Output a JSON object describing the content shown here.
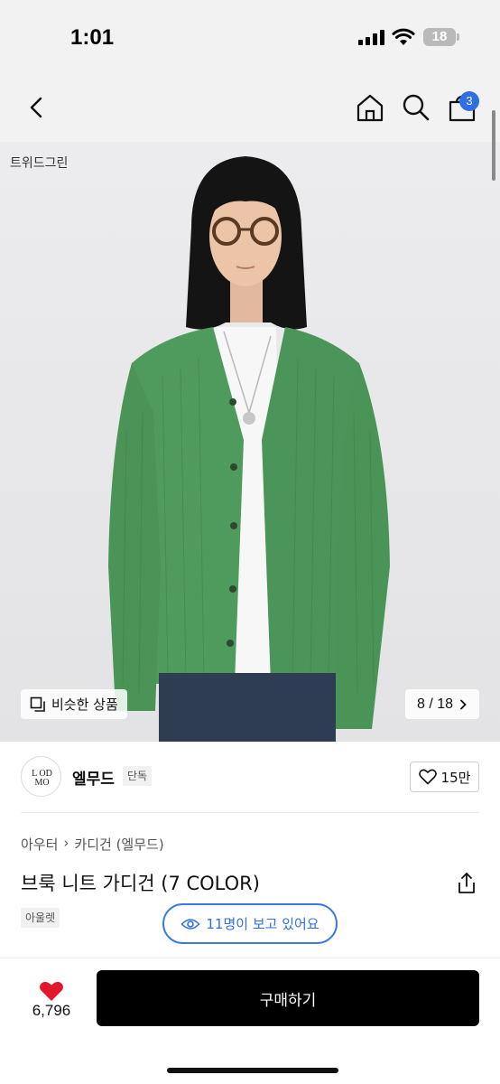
{
  "status_bar": {
    "time": "1:01",
    "battery_level": "18",
    "icons": [
      "signal-icon",
      "wifi-icon",
      "battery-icon"
    ]
  },
  "nav": {
    "icons": [
      "back-icon",
      "home-icon",
      "search-icon",
      "cart-icon"
    ],
    "cart_count": "3"
  },
  "hero": {
    "color_label": "트위드그린",
    "similar_products_label": "비슷한 상품",
    "page_indicator": "8 / 18"
  },
  "brand": {
    "name": "엘무드",
    "exclusive_badge": "단독",
    "logo_text": "LMOOD",
    "like_count": "15만"
  },
  "product": {
    "breadcrumb": [
      "아우터",
      "카디건 (엘무드)"
    ],
    "title": "브룩 니트 가디건 (7 COLOR)",
    "outlet_badge": "아울렛",
    "viewers_text": "11명이 보고 있어요"
  },
  "bottom_bar": {
    "wishlist_count": "6,796",
    "buy_label": "구매하기"
  },
  "colors": {
    "accent_blue": "#2f6fe4",
    "heart_red": "#e3172b",
    "buy_button": "#000000",
    "cardigan_green": "#4e9a5c"
  }
}
